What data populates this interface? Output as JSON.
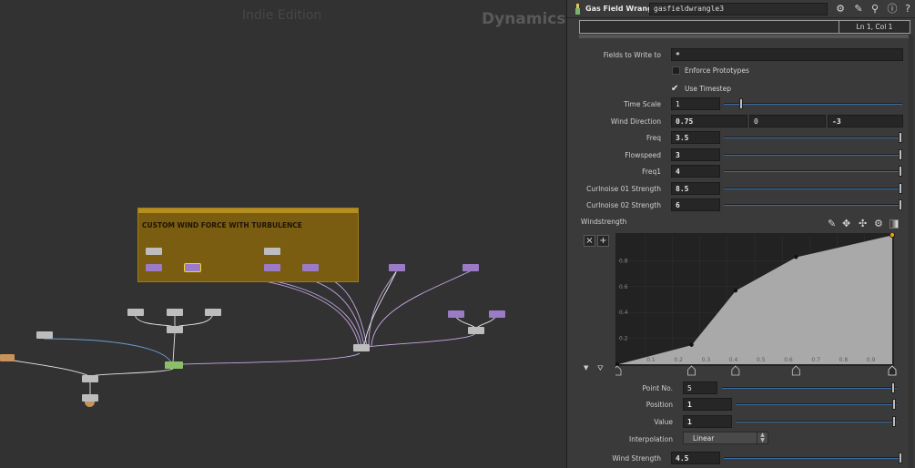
{
  "network": {
    "watermark_edition": "Indie Edition",
    "watermark_context": "Dynamics",
    "network_box_title": "CUSTOM WIND FORCE WITH TURBULENCE"
  },
  "params": {
    "node_type": "Gas Field Wrangle",
    "node_name": "gasfieldwrangle3",
    "cursor_position": "Ln 1, Col 1",
    "fields_to_write_label": "Fields to Write to",
    "fields_to_write_value": "*",
    "enforce_prototypes_label": "Enforce Prototypes",
    "enforce_prototypes_checked": false,
    "use_timestep_label": "Use Timestep",
    "use_timestep_checked": true,
    "time_scale_label": "Time Scale",
    "time_scale_value": "1",
    "wind_direction_label": "Wind Direction",
    "wind_direction_x": "0.75",
    "wind_direction_y": "0",
    "wind_direction_z": "-3",
    "freq_label": "Freq",
    "freq_value": "3.5",
    "flowspeed_label": "Flowspeed",
    "flowspeed_value": "3",
    "freq1_label": "Freq1",
    "freq1_value": "4",
    "curlnoise01_label": "Curlnoise 01 Strength",
    "curlnoise01_value": "8.5",
    "curlnoise02_label": "Curlnoise 02 Strength",
    "curlnoise02_value": "6",
    "windstrength_label": "Windstrength",
    "ramp_remove_label": "×",
    "ramp_add_label": "+",
    "ramp_y_ticks": [
      "0.2",
      "0.4",
      "0.6",
      "0.8"
    ],
    "ramp_x_ticks": [
      "0.1",
      "0.2",
      "0.3",
      "0.4",
      "0.5",
      "0.6",
      "0.7",
      "0.8",
      "0.9"
    ],
    "ramp_points": [
      {
        "pos": 0,
        "value": 0
      },
      {
        "pos": 0.27,
        "value": 0.15
      },
      {
        "pos": 0.43,
        "value": 0.57
      },
      {
        "pos": 0.65,
        "value": 0.83
      },
      {
        "pos": 1,
        "value": 1
      }
    ],
    "point_no_label": "Point No.",
    "point_no_value": "5",
    "position_label": "Position",
    "position_value": "1",
    "value_label": "Value",
    "value_value": "1",
    "interpolation_label": "Interpolation",
    "interpolation_value": "Linear",
    "wind_strength_label": "Wind Strength",
    "wind_strength_value": "4.5",
    "colors": {
      "slider_track": "#3a6ea5",
      "network_box": "#7a5d10",
      "selected_node": "#f1d533"
    }
  }
}
